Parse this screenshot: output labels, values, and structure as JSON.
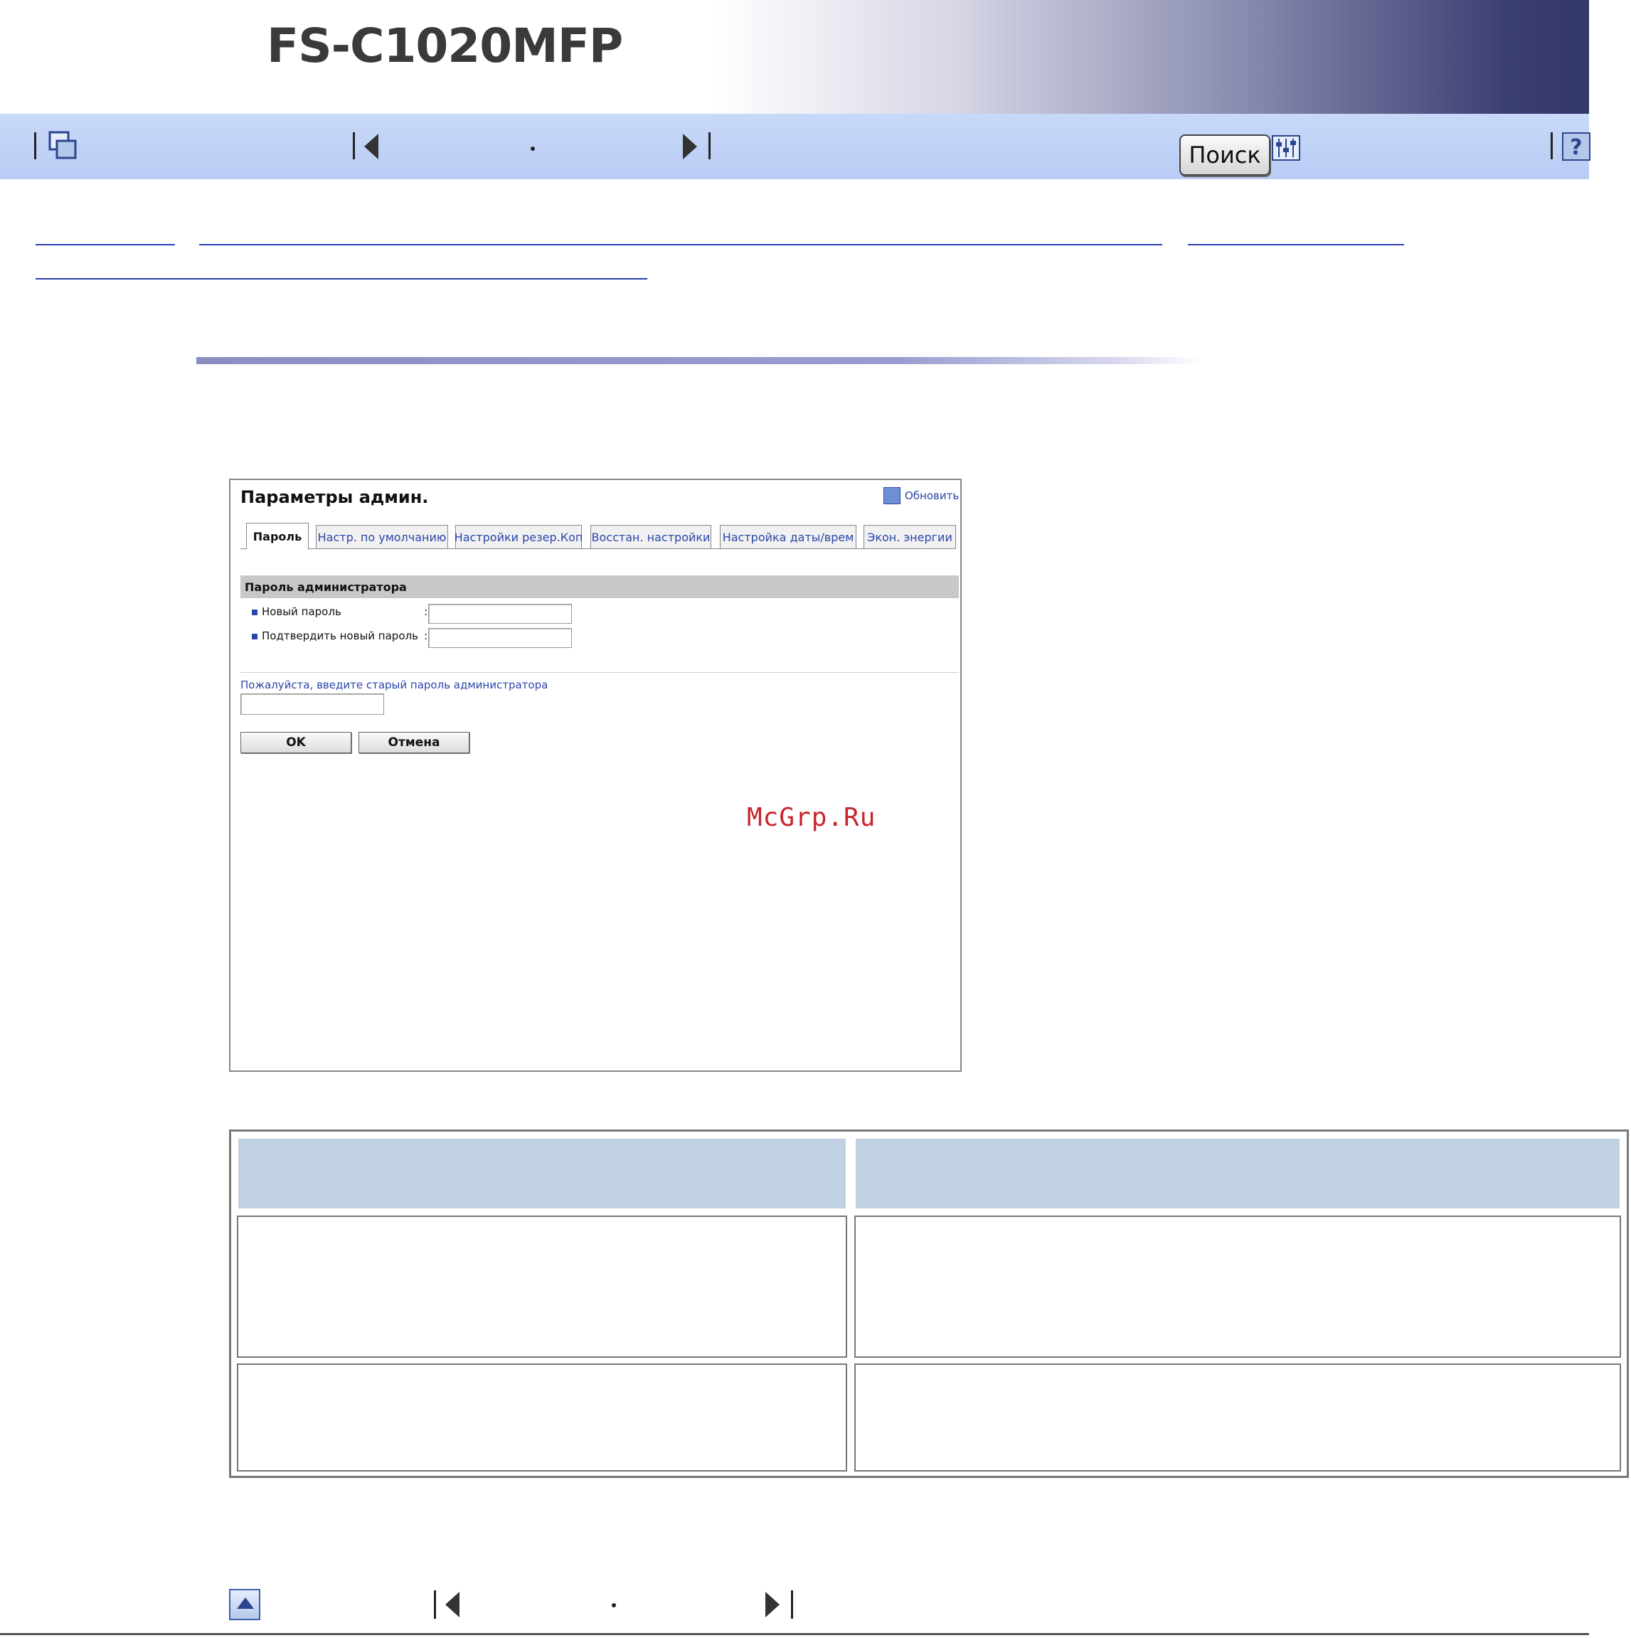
{
  "header": {
    "product_title": "FS-C1020MFP"
  },
  "nav": {
    "search_label": "Поиск"
  },
  "screenshot": {
    "title": "Параметры админ.",
    "refresh_label": "Обновить",
    "tabs": [
      "Пароль",
      "Настр. по умолчанию",
      "Настройки резер.Коп",
      "Восстан. настройки",
      "Настройка даты/врем",
      "Экон. энергии"
    ],
    "group_heading": "Пароль администратора",
    "rows": [
      {
        "label": "Новый пароль"
      },
      {
        "label": "Подтвердить новый пароль"
      }
    ],
    "old_password_label": "Пожалуйста, введите старый пароль администратора",
    "ok_label": "OK",
    "cancel_label": "Отмена"
  },
  "watermark": "McGrp.Ru",
  "colors": {
    "nav_bar": "#c2d4f6",
    "table_header": "#c0d2e2",
    "link": "#2a3fb0"
  }
}
